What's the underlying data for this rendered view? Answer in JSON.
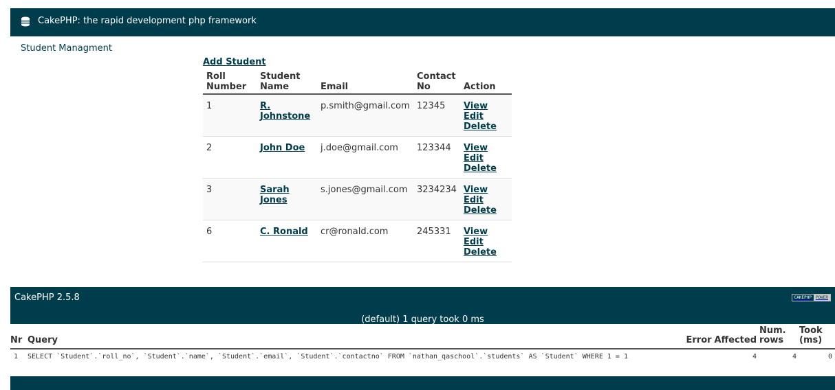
{
  "header": {
    "title": "CakePHP: the rapid development php framework"
  },
  "sidebar": {
    "label": "Student Managment"
  },
  "actions": {
    "add_student": "Add Student"
  },
  "students_table": {
    "headers": [
      "Roll Number",
      "Student Name",
      "Email",
      "Contact No",
      "Action"
    ],
    "rows": [
      {
        "roll": "1",
        "name": "R. Johnstone",
        "email": "p.smith@gmail.com",
        "contact": "12345"
      },
      {
        "roll": "2",
        "name": "John Doe",
        "email": "j.doe@gmail.com",
        "contact": "123344"
      },
      {
        "roll": "3",
        "name": "Sarah Jones",
        "email": "s.jones@gmail.com",
        "contact": "3234234"
      },
      {
        "roll": "6",
        "name": "C. Ronald",
        "email": "cr@ronald.com",
        "contact": "245331"
      }
    ],
    "action_labels": {
      "view": "View",
      "edit": "Edit",
      "delete": "Delete"
    }
  },
  "footer": {
    "version": "CakePHP 2.5.8",
    "powered_badge": [
      "CAKEPHP",
      "POWER"
    ],
    "sql_summary": "(default) 1 query took 0 ms"
  },
  "sql_log": {
    "headers": [
      "Nr",
      "Query",
      "Error",
      "Affected",
      "Num. rows",
      "Took (ms)"
    ],
    "rows": [
      {
        "nr": "1",
        "query": "SELECT `Student`.`roll_no`, `Student`.`name`, `Student`.`email`, `Student`.`contactno` FROM `nathan_qaschool`.`students` AS `Student` WHERE 1 = 1",
        "error": "",
        "affected": "4",
        "num_rows": "4",
        "took": "0"
      }
    ]
  },
  "colors": {
    "brand": "#003d4c",
    "row_alt": "#f9f9f9"
  },
  "icons": {
    "logo": "cake-logo-icon"
  }
}
